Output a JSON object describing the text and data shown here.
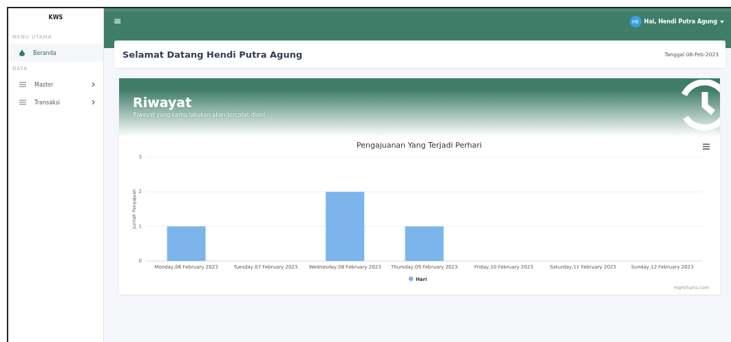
{
  "sidebar": {
    "brand": "KWS",
    "sections": [
      {
        "heading": "MENU UTAMA",
        "items": [
          {
            "label": "Beranda",
            "kind": "home",
            "selected": true,
            "expandable": false
          }
        ]
      },
      {
        "heading": "DATA",
        "items": [
          {
            "label": "Master",
            "kind": "list",
            "selected": false,
            "expandable": true
          },
          {
            "label": "Transaksi",
            "kind": "list",
            "selected": false,
            "expandable": true
          }
        ]
      }
    ]
  },
  "topbar": {
    "menu_icon": "≡",
    "avatar": "HE",
    "user": "Hai, Hendi Putra Agung"
  },
  "welcome": {
    "title": "Selamat Datang Hendi Putra Agung",
    "date": "Tanggal 08-Feb-2023"
  },
  "history": {
    "title": "Riwayat",
    "subtitle": "Riwayat yang kamu lakukan akan tercatat disini",
    "chart_data": {
      "type": "bar",
      "title": "Pengajuanan Yang Terjadi Perhari",
      "ylabel": "Jumlah Pengajuan",
      "categories": [
        "Monday,06 February 2023",
        "Tuesday,07 February 2023",
        "Wednesday,08 February 2023",
        "Thursday,09 February 2023",
        "Friday,10 February 2023",
        "Saturday,11 February 2023",
        "Sunday,12 February 2023"
      ],
      "series": [
        {
          "name": "Hari",
          "color": "#7cb5ec",
          "values": [
            1,
            0,
            2,
            1,
            0,
            0,
            0
          ]
        }
      ],
      "ylim": [
        0,
        3
      ],
      "yticks": [
        0,
        1,
        2,
        3
      ]
    },
    "credits": "Highcharts.com"
  }
}
